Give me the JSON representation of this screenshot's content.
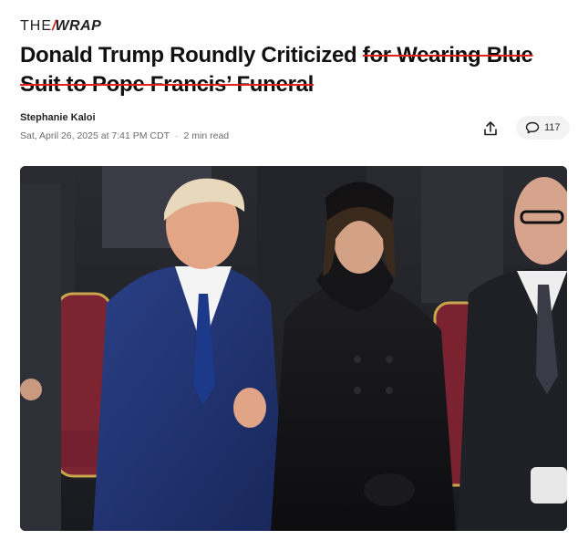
{
  "site": {
    "logo_the": "THE",
    "logo_wrap": "WRAP"
  },
  "article": {
    "title_part1": "Donald Trump Roundly Criticized ",
    "title_part2": "for Wearing Blue Suit to Pope Francis’ Funeral",
    "author": "Stephanie Kaloi",
    "date": "Sat, April 26, 2025 at 7:41 PM CDT",
    "separator": "·",
    "read_time": "2 min read"
  },
  "actions": {
    "share_icon": "share-icon",
    "comment_icon": "comment-bubble-icon",
    "comment_count": "117"
  },
  "image": {
    "subject": "hero-photo"
  },
  "colors": {
    "accent_red": "#d8231e",
    "meta_gray": "#6b6b6b"
  }
}
